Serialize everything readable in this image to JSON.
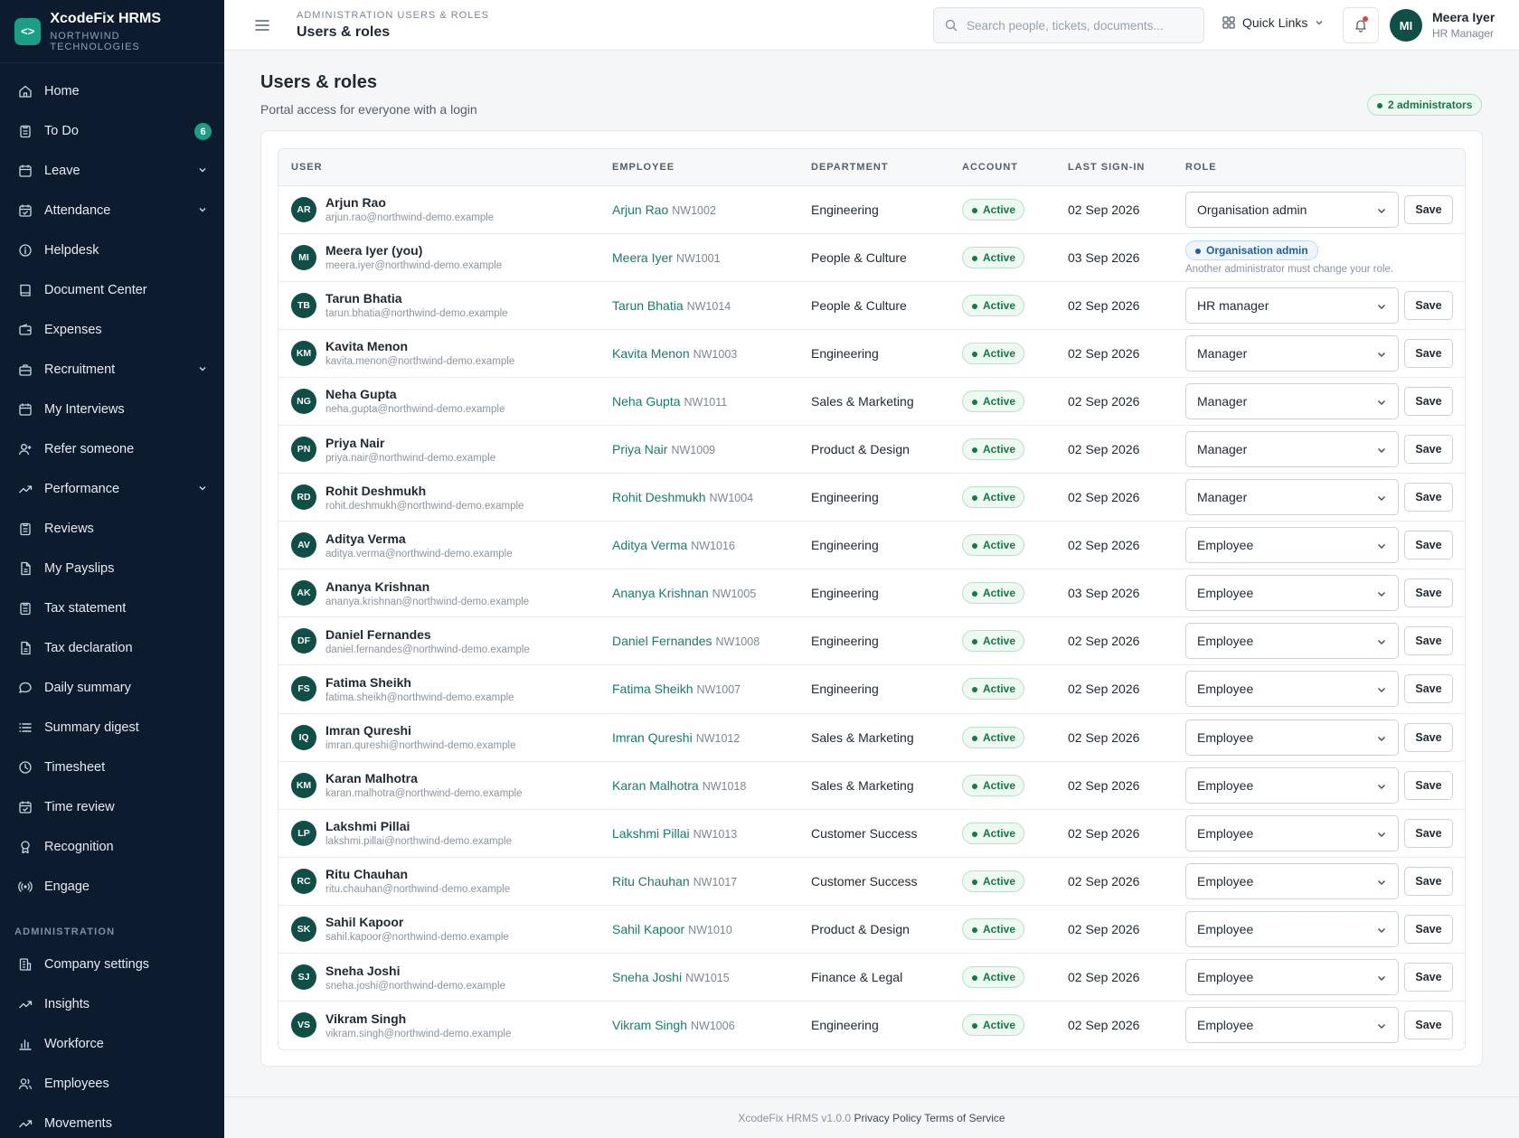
{
  "brand": {
    "name": "XcodeFix HRMS",
    "org": "NORTHWIND TECHNOLOGIES",
    "logo_icon": "code-icon"
  },
  "sidebar": {
    "items": [
      {
        "label": "Home",
        "icon": "home-icon"
      },
      {
        "label": "To Do",
        "icon": "clipboard-icon",
        "badge": "6"
      },
      {
        "label": "Leave",
        "icon": "calendar-icon",
        "expandable": true
      },
      {
        "label": "Attendance",
        "icon": "calendar-check-icon",
        "expandable": true
      },
      {
        "label": "Helpdesk",
        "icon": "info-icon"
      },
      {
        "label": "Document Center",
        "icon": "book-icon"
      },
      {
        "label": "Expenses",
        "icon": "wallet-icon"
      },
      {
        "label": "Recruitment",
        "icon": "briefcase-icon",
        "expandable": true
      },
      {
        "label": "My Interviews",
        "icon": "calendar-icon"
      },
      {
        "label": "Refer someone",
        "icon": "user-plus-icon"
      },
      {
        "label": "Performance",
        "icon": "trend-icon",
        "expandable": true
      },
      {
        "label": "Reviews",
        "icon": "clipboard-icon"
      },
      {
        "label": "My Payslips",
        "icon": "file-icon"
      },
      {
        "label": "Tax statement",
        "icon": "clipboard-icon"
      },
      {
        "label": "Tax declaration",
        "icon": "file-icon"
      },
      {
        "label": "Daily summary",
        "icon": "chat-icon"
      },
      {
        "label": "Summary digest",
        "icon": "list-icon"
      },
      {
        "label": "Timesheet",
        "icon": "clock-icon"
      },
      {
        "label": "Time review",
        "icon": "calendar-check-icon"
      },
      {
        "label": "Recognition",
        "icon": "award-icon"
      },
      {
        "label": "Engage",
        "icon": "broadcast-icon"
      }
    ],
    "admin_section": "ADMINISTRATION",
    "admin_items": [
      {
        "label": "Company settings",
        "icon": "building-icon"
      },
      {
        "label": "Insights",
        "icon": "trend-icon"
      },
      {
        "label": "Workforce",
        "icon": "bar-chart-icon"
      },
      {
        "label": "Employees",
        "icon": "users-icon"
      },
      {
        "label": "Movements",
        "icon": "trend-icon"
      }
    ]
  },
  "topbar": {
    "breadcrumb": "ADMINISTRATION USERS & ROLES",
    "title": "Users & roles",
    "search_placeholder": "Search people, tickets, documents...",
    "quick_links": "Quick Links",
    "user_initials": "MI",
    "user_name": "Meera Iyer",
    "user_role": "HR Manager"
  },
  "page": {
    "title": "Users & roles",
    "subtitle": "Portal access for everyone with a login",
    "admins_badge": "2 administrators"
  },
  "table": {
    "headers": [
      "USER",
      "EMPLOYEE",
      "DEPARTMENT",
      "ACCOUNT",
      "LAST SIGN-IN",
      "ROLE"
    ],
    "save_label": "Save",
    "rows": [
      {
        "initials": "AR",
        "name": "Arjun Rao",
        "email": "arjun.rao@northwind-demo.example",
        "employee": "Arjun Rao",
        "emp_id": "NW1002",
        "department": "Engineering",
        "account": "Active",
        "last_sign_in": "02 Sep 2026",
        "role": "Organisation admin"
      },
      {
        "initials": "MI",
        "name": "Meera Iyer (you)",
        "email": "meera.iyer@northwind-demo.example",
        "employee": "Meera Iyer",
        "emp_id": "NW1001",
        "department": "People & Culture",
        "account": "Active",
        "last_sign_in": "03 Sep 2026",
        "role": "Organisation admin",
        "locked": true,
        "note": "Another administrator must change your role."
      },
      {
        "initials": "TB",
        "name": "Tarun Bhatia",
        "email": "tarun.bhatia@northwind-demo.example",
        "employee": "Tarun Bhatia",
        "emp_id": "NW1014",
        "department": "People & Culture",
        "account": "Active",
        "last_sign_in": "02 Sep 2026",
        "role": "HR manager"
      },
      {
        "initials": "KM",
        "name": "Kavita Menon",
        "email": "kavita.menon@northwind-demo.example",
        "employee": "Kavita Menon",
        "emp_id": "NW1003",
        "department": "Engineering",
        "account": "Active",
        "last_sign_in": "02 Sep 2026",
        "role": "Manager"
      },
      {
        "initials": "NG",
        "name": "Neha Gupta",
        "email": "neha.gupta@northwind-demo.example",
        "employee": "Neha Gupta",
        "emp_id": "NW1011",
        "department": "Sales & Marketing",
        "account": "Active",
        "last_sign_in": "02 Sep 2026",
        "role": "Manager"
      },
      {
        "initials": "PN",
        "name": "Priya Nair",
        "email": "priya.nair@northwind-demo.example",
        "employee": "Priya Nair",
        "emp_id": "NW1009",
        "department": "Product & Design",
        "account": "Active",
        "last_sign_in": "02 Sep 2026",
        "role": "Manager"
      },
      {
        "initials": "RD",
        "name": "Rohit Deshmukh",
        "email": "rohit.deshmukh@northwind-demo.example",
        "employee": "Rohit Deshmukh",
        "emp_id": "NW1004",
        "department": "Engineering",
        "account": "Active",
        "last_sign_in": "02 Sep 2026",
        "role": "Manager"
      },
      {
        "initials": "AV",
        "name": "Aditya Verma",
        "email": "aditya.verma@northwind-demo.example",
        "employee": "Aditya Verma",
        "emp_id": "NW1016",
        "department": "Engineering",
        "account": "Active",
        "last_sign_in": "02 Sep 2026",
        "role": "Employee"
      },
      {
        "initials": "AK",
        "name": "Ananya Krishnan",
        "email": "ananya.krishnan@northwind-demo.example",
        "employee": "Ananya Krishnan",
        "emp_id": "NW1005",
        "department": "Engineering",
        "account": "Active",
        "last_sign_in": "03 Sep 2026",
        "role": "Employee"
      },
      {
        "initials": "DF",
        "name": "Daniel Fernandes",
        "email": "daniel.fernandes@northwind-demo.example",
        "employee": "Daniel Fernandes",
        "emp_id": "NW1008",
        "department": "Engineering",
        "account": "Active",
        "last_sign_in": "02 Sep 2026",
        "role": "Employee"
      },
      {
        "initials": "FS",
        "name": "Fatima Sheikh",
        "email": "fatima.sheikh@northwind-demo.example",
        "employee": "Fatima Sheikh",
        "emp_id": "NW1007",
        "department": "Engineering",
        "account": "Active",
        "last_sign_in": "02 Sep 2026",
        "role": "Employee"
      },
      {
        "initials": "IQ",
        "name": "Imran Qureshi",
        "email": "imran.qureshi@northwind-demo.example",
        "employee": "Imran Qureshi",
        "emp_id": "NW1012",
        "department": "Sales & Marketing",
        "account": "Active",
        "last_sign_in": "02 Sep 2026",
        "role": "Employee"
      },
      {
        "initials": "KM",
        "name": "Karan Malhotra",
        "email": "karan.malhotra@northwind-demo.example",
        "employee": "Karan Malhotra",
        "emp_id": "NW1018",
        "department": "Sales & Marketing",
        "account": "Active",
        "last_sign_in": "02 Sep 2026",
        "role": "Employee"
      },
      {
        "initials": "LP",
        "name": "Lakshmi Pillai",
        "email": "lakshmi.pillai@northwind-demo.example",
        "employee": "Lakshmi Pillai",
        "emp_id": "NW1013",
        "department": "Customer Success",
        "account": "Active",
        "last_sign_in": "02 Sep 2026",
        "role": "Employee"
      },
      {
        "initials": "RC",
        "name": "Ritu Chauhan",
        "email": "ritu.chauhan@northwind-demo.example",
        "employee": "Ritu Chauhan",
        "emp_id": "NW1017",
        "department": "Customer Success",
        "account": "Active",
        "last_sign_in": "02 Sep 2026",
        "role": "Employee"
      },
      {
        "initials": "SK",
        "name": "Sahil Kapoor",
        "email": "sahil.kapoor@northwind-demo.example",
        "employee": "Sahil Kapoor",
        "emp_id": "NW1010",
        "department": "Product & Design",
        "account": "Active",
        "last_sign_in": "02 Sep 2026",
        "role": "Employee"
      },
      {
        "initials": "SJ",
        "name": "Sneha Joshi",
        "email": "sneha.joshi@northwind-demo.example",
        "employee": "Sneha Joshi",
        "emp_id": "NW1015",
        "department": "Finance & Legal",
        "account": "Active",
        "last_sign_in": "02 Sep 2026",
        "role": "Employee"
      },
      {
        "initials": "VS",
        "name": "Vikram Singh",
        "email": "vikram.singh@northwind-demo.example",
        "employee": "Vikram Singh",
        "emp_id": "NW1006",
        "department": "Engineering",
        "account": "Active",
        "last_sign_in": "02 Sep 2026",
        "role": "Employee"
      }
    ]
  },
  "footer": {
    "version": "XcodeFix HRMS v1.0.0",
    "privacy": "Privacy Policy",
    "terms": "Terms of Service"
  },
  "colors": {
    "sidebar_bg": "#0d1b2e",
    "accent": "#1b9e86",
    "avatar_bg": "#0f4f45",
    "link": "#1a7a6b",
    "status_green": "#137a44"
  }
}
